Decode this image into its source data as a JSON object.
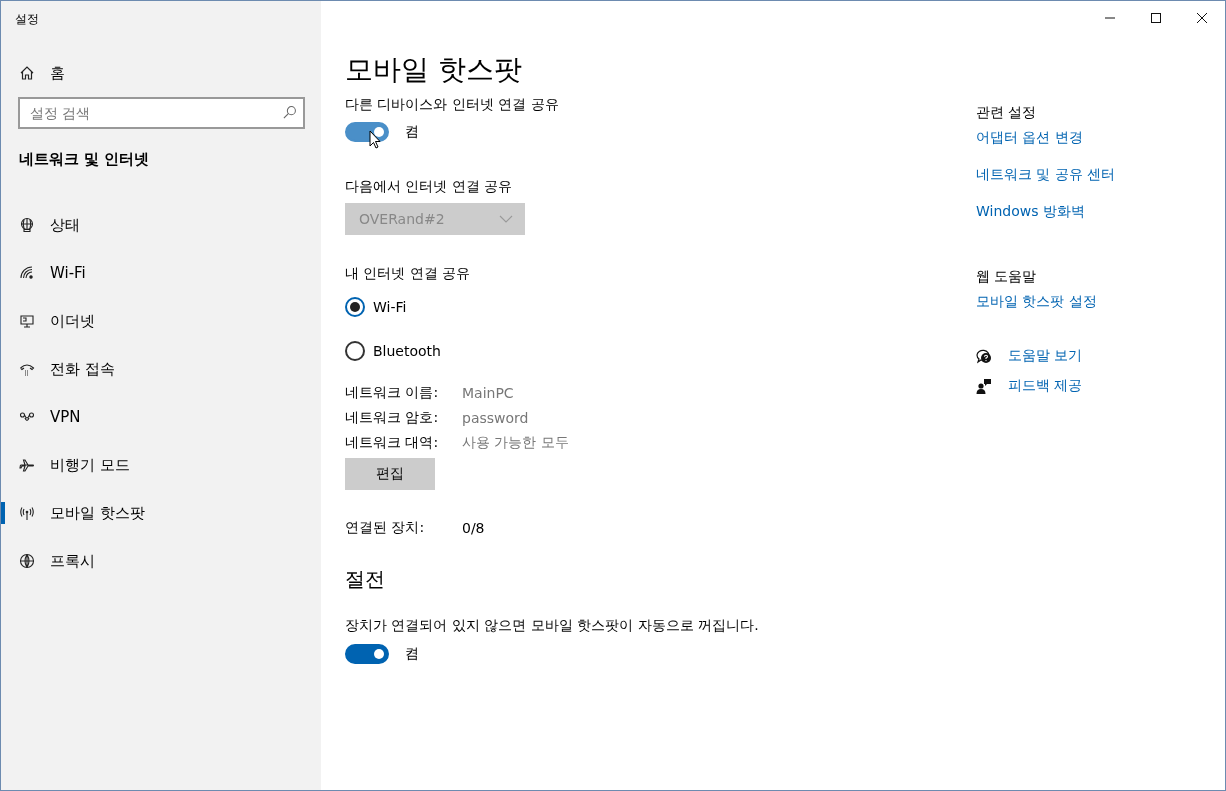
{
  "window": {
    "title": "설정"
  },
  "sidebar": {
    "home": "홈",
    "search": {
      "placeholder": "설정 검색"
    },
    "section": "네트워크 및 인터넷",
    "items": [
      {
        "label": "상태",
        "selected": false
      },
      {
        "label": "Wi-Fi",
        "selected": false
      },
      {
        "label": "이더넷",
        "selected": false
      },
      {
        "label": "전화 접속",
        "selected": false
      },
      {
        "label": "VPN",
        "selected": false
      },
      {
        "label": "비행기 모드",
        "selected": false
      },
      {
        "label": "모바일 핫스팟",
        "selected": true
      },
      {
        "label": "프록시",
        "selected": false
      }
    ]
  },
  "main": {
    "title": "모바일 핫스팟",
    "share_toggle": {
      "label": "다른 디바이스와 인터넷 연결 공유",
      "on": true,
      "hovered": true,
      "state_text": "켬"
    },
    "share_from": {
      "label": "다음에서 인터넷 연결 공유",
      "value": "OVERand#2",
      "disabled": true
    },
    "share_over": {
      "label": "내 인터넷 연결 공유",
      "options": [
        {
          "label": "Wi-Fi",
          "selected": true
        },
        {
          "label": "Bluetooth",
          "selected": false
        }
      ]
    },
    "details": [
      {
        "label": "네트워크 이름:",
        "value": "MainPC"
      },
      {
        "label": "네트워크 암호:",
        "value": "password"
      },
      {
        "label": "네트워크 대역:",
        "value": "사용 가능한 모두"
      }
    ],
    "edit_button": "편집",
    "connected": {
      "label": "연결된 장치:",
      "value": "0/8"
    },
    "power_saving": {
      "heading": "절전",
      "description": "장치가 연결되어 있지 않으면 모바일 핫스팟이 자동으로 꺼집니다.",
      "toggle": {
        "on": true,
        "state_text": "켬"
      }
    }
  },
  "related": {
    "heading": "관련 설정",
    "links": [
      "어댑터 옵션 변경",
      "네트워크 및 공유 센터",
      "Windows 방화벽"
    ]
  },
  "web_help": {
    "heading": "웹 도움말",
    "links": [
      "모바일 핫스팟 설정"
    ]
  },
  "help_links": [
    {
      "label": "도움말 보기"
    },
    {
      "label": "피드백 제공"
    }
  ]
}
